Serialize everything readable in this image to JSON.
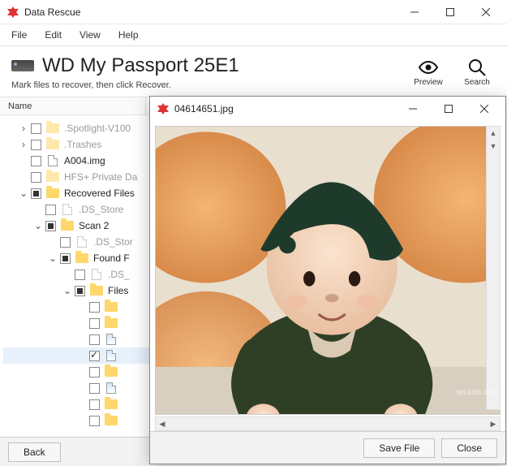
{
  "app": {
    "title": "Data Rescue"
  },
  "menu": {
    "file": "File",
    "edit": "Edit",
    "view": "View",
    "help": "Help"
  },
  "header": {
    "drive_title": "WD My Passport 25E1",
    "subtitle": "Mark files to recover, then click Recover.",
    "tools": {
      "preview": "Preview",
      "search": "Search"
    }
  },
  "columns": {
    "name": "Name"
  },
  "tree": {
    "spotlight": ".Spotlight-V100",
    "trashes": ".Trashes",
    "a004": "A004.img",
    "hfs": "HFS+ Private Da",
    "recovered": "Recovered Files",
    "dsstore1": ".DS_Store",
    "scan2": "Scan 2",
    "dsstor": ".DS_Stor",
    "foundf": "Found F",
    "ds": ".DS_",
    "files": "Files",
    "items": [
      {
        "icon": "folder",
        "check": "none"
      },
      {
        "icon": "folder",
        "check": "none"
      },
      {
        "icon": "pic",
        "check": "none"
      },
      {
        "icon": "pic",
        "check": "checked",
        "selected": true
      },
      {
        "icon": "folder",
        "check": "none"
      },
      {
        "icon": "pic",
        "check": "none"
      },
      {
        "icon": "folder",
        "check": "none"
      },
      {
        "icon": "folder",
        "check": "none"
      }
    ]
  },
  "footer": {
    "back": "Back"
  },
  "preview": {
    "title": "04614651.jpg",
    "save": "Save File",
    "close": "Close"
  },
  "watermark": "wsxdn.com"
}
